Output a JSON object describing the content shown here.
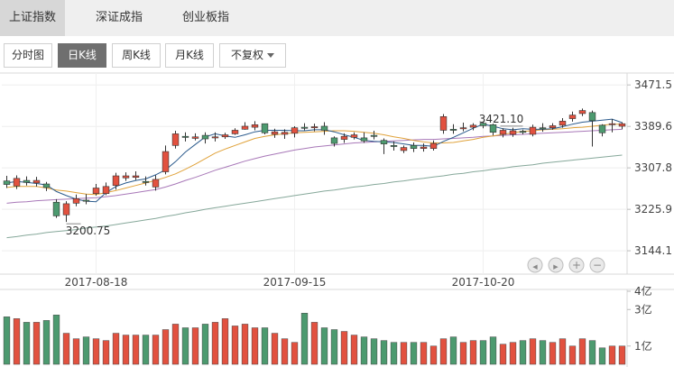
{
  "index_tabs": [
    {
      "label": "上证指数",
      "active": true
    },
    {
      "label": "深证成指",
      "active": false
    },
    {
      "label": "创业板指",
      "active": false
    }
  ],
  "period_tabs": [
    {
      "label": "分时图",
      "active": false
    },
    {
      "label": "日K线",
      "active": true
    },
    {
      "label": "周K线",
      "active": false
    },
    {
      "label": "月K线",
      "active": false
    }
  ],
  "adjust_select": {
    "label": "不复权"
  },
  "colors": {
    "up": "#e2513f",
    "down": "#4c9a6f",
    "ma5": "#2a5a8c",
    "ma10": "#e0a23a",
    "ma20": "#a878b8",
    "ma60": "#86a89a"
  },
  "chart_data": {
    "type": "candlestick",
    "price_axis": {
      "ticks": [
        "3471.5",
        "3389.6",
        "3307.8",
        "3225.9",
        "3144.1"
      ],
      "ylim": [
        3098,
        3495
      ]
    },
    "date_labels": [
      {
        "index": 9,
        "label": "2017-08-18"
      },
      {
        "index": 29,
        "label": "2017-09-15"
      },
      {
        "index": 48,
        "label": "2017-10-20"
      }
    ],
    "high_annotation": {
      "index": 52,
      "label": "3421.10"
    },
    "low_annotation": {
      "index": 6,
      "label": "3200.75"
    },
    "volume_axis": {
      "ticks": [
        "4亿",
        "3亿",
        "1亿"
      ],
      "ylim": [
        0,
        4
      ]
    },
    "candles": [
      [
        3282,
        3275,
        3292,
        3268
      ],
      [
        3272,
        3287,
        3293,
        3266
      ],
      [
        3283,
        3279,
        3291,
        3273
      ],
      [
        3278,
        3283,
        3290,
        3271
      ],
      [
        3276,
        3269,
        3280,
        3262
      ],
      [
        3240,
        3213,
        3246,
        3209
      ],
      [
        3215,
        3237,
        3242,
        3201
      ],
      [
        3238,
        3247,
        3255,
        3232
      ],
      [
        3244,
        3243,
        3256,
        3236
      ],
      [
        3257,
        3268,
        3276,
        3253
      ],
      [
        3257,
        3271,
        3279,
        3254
      ],
      [
        3273,
        3292,
        3298,
        3265
      ],
      [
        3288,
        3292,
        3299,
        3282
      ],
      [
        3289,
        3292,
        3301,
        3284
      ],
      [
        3281,
        3280,
        3291,
        3273
      ],
      [
        3270,
        3285,
        3293,
        3263
      ],
      [
        3300,
        3340,
        3352,
        3295
      ],
      [
        3352,
        3375,
        3381,
        3346
      ],
      [
        3370,
        3368,
        3378,
        3360
      ],
      [
        3366,
        3369,
        3376,
        3362
      ],
      [
        3372,
        3365,
        3378,
        3356
      ],
      [
        3367,
        3369,
        3378,
        3360
      ],
      [
        3369,
        3373,
        3377,
        3365
      ],
      [
        3375,
        3382,
        3386,
        3373
      ],
      [
        3384,
        3390,
        3398,
        3383
      ],
      [
        3388,
        3393,
        3400,
        3382
      ],
      [
        3395,
        3377,
        3395,
        3374
      ],
      [
        3374,
        3379,
        3385,
        3367
      ],
      [
        3374,
        3378,
        3384,
        3365
      ],
      [
        3376,
        3387,
        3390,
        3368
      ],
      [
        3388,
        3387,
        3396,
        3382
      ],
      [
        3388,
        3389,
        3395,
        3380
      ],
      [
        3390,
        3382,
        3398,
        3373
      ],
      [
        3367,
        3356,
        3370,
        3350
      ],
      [
        3364,
        3370,
        3376,
        3357
      ],
      [
        3368,
        3373,
        3378,
        3364
      ],
      [
        3367,
        3361,
        3378,
        3357
      ],
      [
        3372,
        3371,
        3381,
        3364
      ],
      [
        3362,
        3355,
        3366,
        3335
      ],
      [
        3352,
        3350,
        3360,
        3342
      ],
      [
        3342,
        3348,
        3352,
        3337
      ],
      [
        3352,
        3346,
        3358,
        3339
      ],
      [
        3346,
        3349,
        3356,
        3340
      ],
      [
        3346,
        3356,
        3362,
        3342
      ],
      [
        3382,
        3409,
        3414,
        3375
      ],
      [
        3384,
        3382,
        3394,
        3375
      ],
      [
        3386,
        3387,
        3397,
        3380
      ],
      [
        3388,
        3392,
        3396,
        3382
      ],
      [
        3396,
        3391,
        3399,
        3386
      ],
      [
        3393,
        3378,
        3395,
        3372
      ],
      [
        3374,
        3382,
        3386,
        3368
      ],
      [
        3374,
        3381,
        3387,
        3369
      ],
      [
        3380,
        3378,
        3383,
        3374
      ],
      [
        3374,
        3388,
        3393,
        3370
      ],
      [
        3387,
        3385,
        3396,
        3379
      ],
      [
        3387,
        3391,
        3396,
        3383
      ],
      [
        3392,
        3400,
        3406,
        3387
      ],
      [
        3405,
        3412,
        3419,
        3399
      ],
      [
        3415,
        3421,
        3425,
        3410
      ],
      [
        3417,
        3401,
        3421,
        3350
      ],
      [
        3392,
        3377,
        3394,
        3370
      ],
      [
        3393,
        3395,
        3404,
        3378
      ],
      [
        3390,
        3395,
        3398,
        3384
      ]
    ],
    "volumes": [
      2.6,
      2.5,
      2.3,
      2.3,
      2.4,
      2.7,
      1.7,
      1.4,
      1.5,
      1.4,
      1.3,
      1.7,
      1.6,
      1.6,
      1.6,
      1.6,
      1.9,
      2.2,
      2.0,
      2.0,
      2.2,
      2.3,
      2.5,
      2.1,
      2.2,
      2.0,
      2.0,
      1.7,
      1.4,
      1.2,
      2.8,
      2.3,
      2.0,
      1.9,
      1.8,
      1.6,
      1.5,
      1.4,
      1.3,
      1.2,
      1.2,
      1.2,
      1.2,
      1.0,
      1.4,
      1.5,
      1.2,
      1.3,
      1.3,
      1.5,
      1.1,
      1.2,
      1.3,
      1.4,
      1.3,
      1.2,
      1.4,
      1.0,
      1.4,
      1.3,
      0.9,
      1.0,
      1.0
    ],
    "ma5": [
      3278,
      3281,
      3279,
      3277,
      3274,
      3261,
      3253,
      3246,
      3242,
      3241,
      3259,
      3271,
      3278,
      3283,
      3286,
      3294,
      3304,
      3320,
      3339,
      3354,
      3369,
      3375,
      3371,
      3368,
      3373,
      3379,
      3382,
      3382,
      3382,
      3381,
      3381,
      3383,
      3383,
      3379,
      3373,
      3368,
      3362,
      3360,
      3359,
      3358,
      3355,
      3352,
      3352,
      3350,
      3360,
      3368,
      3377,
      3386,
      3394,
      3390,
      3385,
      3383,
      3385,
      3384,
      3384,
      3385,
      3389,
      3394,
      3398,
      3400,
      3402,
      3404,
      3397
    ],
    "ma10": [
      3269,
      3271,
      3271,
      3271,
      3268,
      3264,
      3262,
      3259,
      3256,
      3255,
      3259,
      3263,
      3268,
      3273,
      3278,
      3283,
      3289,
      3296,
      3305,
      3315,
      3326,
      3337,
      3345,
      3352,
      3359,
      3366,
      3370,
      3373,
      3375,
      3377,
      3378,
      3379,
      3380,
      3381,
      3381,
      3380,
      3378,
      3376,
      3373,
      3369,
      3366,
      3362,
      3359,
      3357,
      3357,
      3358,
      3361,
      3364,
      3368,
      3371,
      3374,
      3377,
      3380,
      3381,
      3383,
      3384,
      3385,
      3387,
      3388,
      3390,
      3392,
      3394,
      3394
    ],
    "ma20": [
      3238,
      3240,
      3241,
      3243,
      3244,
      3245,
      3246,
      3247,
      3248,
      3249,
      3251,
      3253,
      3256,
      3259,
      3262,
      3265,
      3270,
      3276,
      3283,
      3289,
      3296,
      3303,
      3309,
      3315,
      3321,
      3326,
      3331,
      3335,
      3339,
      3343,
      3346,
      3349,
      3351,
      3353,
      3355,
      3357,
      3358,
      3359,
      3360,
      3361,
      3362,
      3363,
      3364,
      3364,
      3365,
      3366,
      3367,
      3368,
      3370,
      3371,
      3372,
      3373,
      3374,
      3375,
      3376,
      3377,
      3378,
      3379,
      3380,
      3381,
      3382,
      3383,
      3384
    ],
    "ma60": [
      3170,
      3172,
      3175,
      3177,
      3180,
      3182,
      3184,
      3186,
      3189,
      3191,
      3193,
      3196,
      3199,
      3202,
      3205,
      3208,
      3212,
      3215,
      3219,
      3222,
      3226,
      3229,
      3232,
      3235,
      3238,
      3241,
      3244,
      3247,
      3250,
      3253,
      3256,
      3259,
      3262,
      3264,
      3267,
      3270,
      3272,
      3275,
      3277,
      3280,
      3282,
      3285,
      3287,
      3290,
      3292,
      3295,
      3297,
      3300,
      3302,
      3305,
      3307,
      3310,
      3312,
      3314,
      3317,
      3319,
      3321,
      3323,
      3325,
      3327,
      3329,
      3331,
      3333
    ]
  }
}
